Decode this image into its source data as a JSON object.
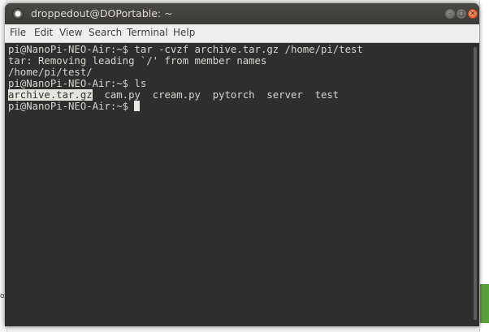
{
  "window": {
    "title": "droppedout@DOPortable: ~",
    "buttons": {
      "minimize": "–",
      "maximize": "□",
      "close": "✕"
    }
  },
  "menu": [
    "File",
    "Edit",
    "View",
    "Search",
    "Terminal",
    "Help"
  ],
  "terminal": {
    "line1": "pi@NanoPi-NEO-Air:~$ tar -cvzf archive.tar.gz /home/pi/test",
    "line2": "tar: Removing leading `/' from member names",
    "line3": "/home/pi/test/",
    "line4": "pi@NanoPi-NEO-Air:~$ ls",
    "ls_files": {
      "selected": "archive.tar.gz",
      "rest": "  cam.py  cream.py  pytorch  server  test"
    },
    "prompt": "pi@NanoPi-NEO-Air:~$ "
  },
  "background": {
    "left_fragment": "ot"
  },
  "colors": {
    "terminal_bg": "#2e2e2e",
    "terminal_fg": "#d6d6d0",
    "close_button": "#e2572b",
    "titlebar": "#3b3a36"
  }
}
